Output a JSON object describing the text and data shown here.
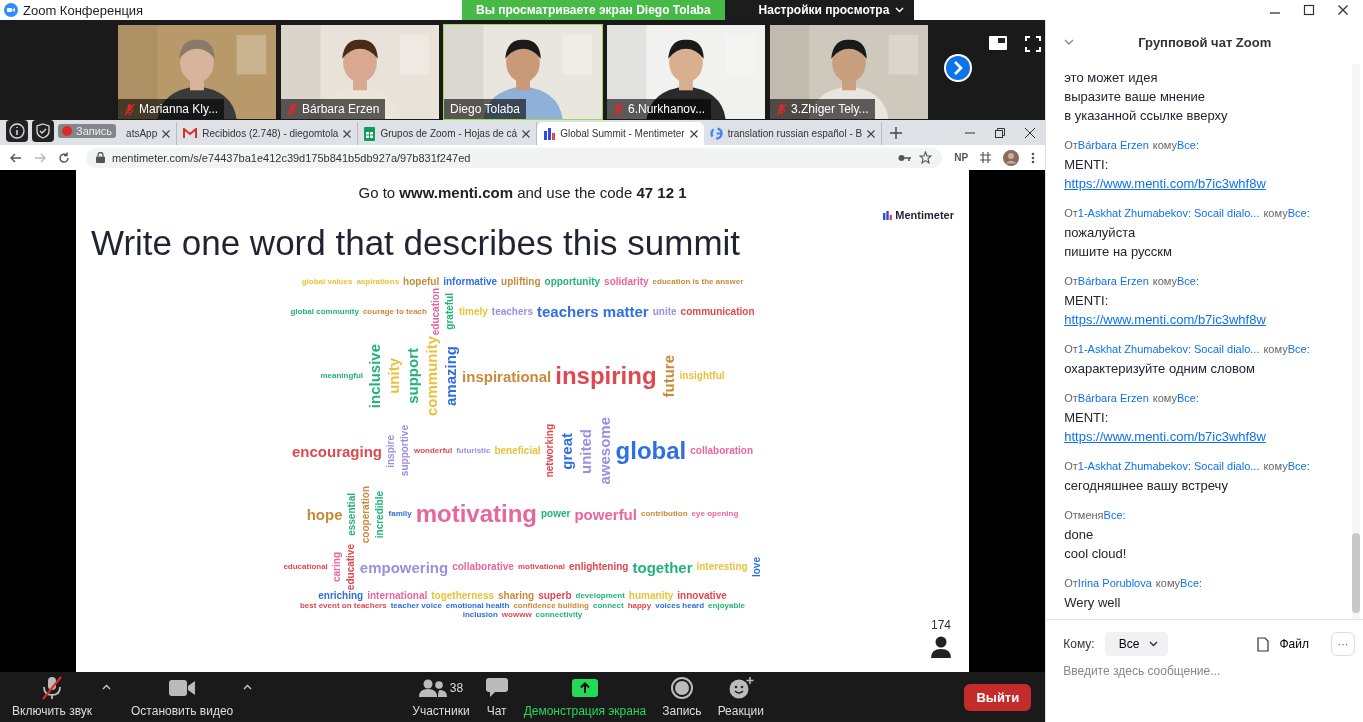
{
  "window": {
    "title": "Zoom Конференция"
  },
  "share_banner": {
    "text": "Вы просматриваете экран Diego Tolaba",
    "view_options": "Настройки просмотра"
  },
  "participants": [
    {
      "name": "Marianna Kly...",
      "muted": true,
      "speaking": false
    },
    {
      "name": "Bárbara Erzen",
      "muted": true,
      "speaking": false
    },
    {
      "name": "Diego Tolaba",
      "muted": false,
      "speaking": true
    },
    {
      "name": "6.Nurkhanov...",
      "muted": true,
      "speaking": false
    },
    {
      "name": "3.Zhiger Tely...",
      "muted": true,
      "speaking": false
    }
  ],
  "recording": {
    "label": "Запись"
  },
  "browser": {
    "tabs": [
      {
        "label": "atsApp",
        "selected": false
      },
      {
        "label": "Recibidos (2.748) - diegomtola",
        "selected": false
      },
      {
        "label": "Grupos de Zoom - Hojas de cá",
        "selected": false
      },
      {
        "label": "Global Summit - Mentimeter",
        "selected": true
      },
      {
        "label": "translation russian español - B",
        "selected": false
      }
    ],
    "url": "mentimeter.com/s/e74437ba1e412c39d175b841b5db927a/97b831f247ed",
    "extension": "NP"
  },
  "slide": {
    "instructions": "Go to **www.menti.com** and use the code **47 12 1**",
    "title": "Write one word that describes this summit",
    "logo": "Mentimeter",
    "responses": "174",
    "words": [
      {
        "text": "global values",
        "color": "#e8c23a",
        "kind": "s",
        "vertical": false
      },
      {
        "text": "aspirations",
        "color": "#e8c23a",
        "kind": "s",
        "vertical": false
      },
      {
        "text": "hopeful",
        "color": "#c98a3a",
        "kind": "m",
        "vertical": false
      },
      {
        "text": "informative",
        "color": "#2f6fe0",
        "kind": "m",
        "vertical": false
      },
      {
        "text": "uplifting",
        "color": "#c98a3a",
        "kind": "m",
        "vertical": false
      },
      {
        "text": "opportunity",
        "color": "#22b37a",
        "kind": "m",
        "vertical": false
      },
      {
        "text": "solidarity",
        "color": "#e8669b",
        "kind": "m",
        "vertical": false
      },
      {
        "text": "education is the answer",
        "color": "#c98a3a",
        "kind": "s",
        "vertical": false
      },
      {
        "text": "global community",
        "color": "#22b37a",
        "kind": "s",
        "vertical": false
      },
      {
        "text": "courage to teach",
        "color": "#c98a3a",
        "kind": "s",
        "vertical": false
      },
      {
        "text": "education",
        "color": "#e8669b",
        "kind": "m",
        "vertical": true
      },
      {
        "text": "grateful",
        "color": "#22b37a",
        "kind": "m",
        "vertical": true
      },
      {
        "text": "timely",
        "color": "#e8c23a",
        "kind": "m",
        "vertical": false
      },
      {
        "text": "teachers",
        "color": "#9a8fe0",
        "kind": "m",
        "vertical": false
      },
      {
        "text": "teachers matter",
        "color": "#2f6fe0",
        "kind": "l",
        "vertical": false
      },
      {
        "text": "unite",
        "color": "#9a8fe0",
        "kind": "m",
        "vertical": false
      },
      {
        "text": "communication",
        "color": "#e0484f",
        "kind": "m",
        "vertical": false
      },
      {
        "text": "meaningful",
        "color": "#22b37a",
        "kind": "s",
        "vertical": false
      },
      {
        "text": "inclusive",
        "color": "#22b37a",
        "kind": "l",
        "vertical": true
      },
      {
        "text": "unity",
        "color": "#e8c23a",
        "kind": "l",
        "vertical": true
      },
      {
        "text": "support",
        "color": "#22b37a",
        "kind": "l",
        "vertical": true
      },
      {
        "text": "community",
        "color": "#e8c23a",
        "kind": "l",
        "vertical": true
      },
      {
        "text": "amazing",
        "color": "#2f6fe0",
        "kind": "l",
        "vertical": true
      },
      {
        "text": "inspirational",
        "color": "#c98a3a",
        "kind": "l",
        "vertical": false
      },
      {
        "text": "inspiring",
        "color": "#e0484f",
        "kind": "xl",
        "vertical": false
      },
      {
        "text": "future",
        "color": "#c98a3a",
        "kind": "l",
        "vertical": true
      },
      {
        "text": "insightful",
        "color": "#e8c23a",
        "kind": "m",
        "vertical": false
      },
      {
        "text": "encouraging",
        "color": "#e0484f",
        "kind": "l",
        "vertical": false
      },
      {
        "text": "inspire",
        "color": "#9a8fe0",
        "kind": "m",
        "vertical": true
      },
      {
        "text": "supportive",
        "color": "#9a8fe0",
        "kind": "m",
        "vertical": true
      },
      {
        "text": "wonderful",
        "color": "#e0484f",
        "kind": "s",
        "vertical": false
      },
      {
        "text": "futuristic",
        "color": "#9a8fe0",
        "kind": "s",
        "vertical": false
      },
      {
        "text": "beneficial",
        "color": "#e8c23a",
        "kind": "m",
        "vertical": false
      },
      {
        "text": "networking",
        "color": "#e0484f",
        "kind": "m",
        "vertical": true
      },
      {
        "text": "great",
        "color": "#2f6fe0",
        "kind": "l",
        "vertical": true
      },
      {
        "text": "united",
        "color": "#9a8fe0",
        "kind": "l",
        "vertical": true
      },
      {
        "text": "awesome",
        "color": "#9a8fe0",
        "kind": "l",
        "vertical": true
      },
      {
        "text": "global",
        "color": "#2f6fe0",
        "kind": "xl",
        "vertical": false
      },
      {
        "text": "collaboration",
        "color": "#e8669b",
        "kind": "m",
        "vertical": false
      },
      {
        "text": "hope",
        "color": "#c98a3a",
        "kind": "l",
        "vertical": false
      },
      {
        "text": "essential",
        "color": "#22b37a",
        "kind": "m",
        "vertical": true
      },
      {
        "text": "cooperation",
        "color": "#c98a3a",
        "kind": "m",
        "vertical": true
      },
      {
        "text": "incredible",
        "color": "#22b37a",
        "kind": "m",
        "vertical": true
      },
      {
        "text": "family",
        "color": "#2f6fe0",
        "kind": "s",
        "vertical": false
      },
      {
        "text": "motivating",
        "color": "#e8669b",
        "kind": "xl",
        "vertical": false
      },
      {
        "text": "power",
        "color": "#22b37a",
        "kind": "m",
        "vertical": false
      },
      {
        "text": "powerful",
        "color": "#e8669b",
        "kind": "l",
        "vertical": false
      },
      {
        "text": "contribution",
        "color": "#c98a3a",
        "kind": "s",
        "vertical": false
      },
      {
        "text": "eye opening",
        "color": "#e8669b",
        "kind": "s",
        "vertical": false
      },
      {
        "text": "educational",
        "color": "#e0484f",
        "kind": "s",
        "vertical": false
      },
      {
        "text": "caring",
        "color": "#e8669b",
        "kind": "m",
        "vertical": true
      },
      {
        "text": "educative",
        "color": "#e0484f",
        "kind": "m",
        "vertical": true
      },
      {
        "text": "empowering",
        "color": "#9a8fe0",
        "kind": "l",
        "vertical": false
      },
      {
        "text": "collaborative",
        "color": "#e8669b",
        "kind": "m",
        "vertical": false
      },
      {
        "text": "motivational",
        "color": "#e0484f",
        "kind": "s",
        "vertical": false
      },
      {
        "text": "enlightening",
        "color": "#e0484f",
        "kind": "m",
        "vertical": false
      },
      {
        "text": "together",
        "color": "#22b37a",
        "kind": "l",
        "vertical": false
      },
      {
        "text": "interesting",
        "color": "#e8c23a",
        "kind": "m",
        "vertical": false
      },
      {
        "text": "love",
        "color": "#2f6fe0",
        "kind": "m",
        "vertical": true
      },
      {
        "text": "enriching",
        "color": "#2f6fe0",
        "kind": "m",
        "vertical": false
      },
      {
        "text": "international",
        "color": "#e8669b",
        "kind": "m",
        "vertical": false
      },
      {
        "text": "togetherness",
        "color": "#e8c23a",
        "kind": "m",
        "vertical": false
      },
      {
        "text": "sharing",
        "color": "#c98a3a",
        "kind": "m",
        "vertical": false
      },
      {
        "text": "superb",
        "color": "#e0484f",
        "kind": "m",
        "vertical": false
      },
      {
        "text": "development",
        "color": "#22b37a",
        "kind": "s",
        "vertical": false
      },
      {
        "text": "humanity",
        "color": "#e8c23a",
        "kind": "m",
        "vertical": false
      },
      {
        "text": "innovative",
        "color": "#e0484f",
        "kind": "m",
        "vertical": false
      },
      {
        "text": "best event on teachers",
        "color": "#e0484f",
        "kind": "s",
        "vertical": false
      },
      {
        "text": "teacher voice",
        "color": "#2f6fe0",
        "kind": "s",
        "vertical": false
      },
      {
        "text": "emotional health",
        "color": "#2f6fe0",
        "kind": "s",
        "vertical": false
      },
      {
        "text": "confidence building",
        "color": "#c98a3a",
        "kind": "s",
        "vertical": false
      },
      {
        "text": "connect",
        "color": "#22b37a",
        "kind": "s",
        "vertical": false
      },
      {
        "text": "happy",
        "color": "#e0484f",
        "kind": "s",
        "vertical": false
      },
      {
        "text": "voices heard",
        "color": "#2f6fe0",
        "kind": "s",
        "vertical": false
      },
      {
        "text": "enjoyable",
        "color": "#22b37a",
        "kind": "s",
        "vertical": false
      },
      {
        "text": "inclusion",
        "color": "#2f6fe0",
        "kind": "s",
        "vertical": false
      },
      {
        "text": "wowww",
        "color": "#e0484f",
        "kind": "s",
        "vertical": false
      },
      {
        "text": "connectivity",
        "color": "#22b37a",
        "kind": "s",
        "vertical": false
      }
    ]
  },
  "toolbar": [
    {
      "label": "Включить звук",
      "kind": "mic-muted",
      "caret": true
    },
    {
      "label": "Остановить видео",
      "kind": "video",
      "caret": true
    },
    {
      "label": "Участники",
      "kind": "participants",
      "caret": false,
      "count": "38"
    },
    {
      "label": "Чат",
      "kind": "chat",
      "caret": false
    },
    {
      "label": "Демонстрация экрана",
      "kind": "share",
      "caret": false
    },
    {
      "label": "Запись",
      "kind": "record",
      "caret": false
    },
    {
      "label": "Реакции",
      "kind": "reactions",
      "caret": false
    }
  ],
  "leave_button": "Выйти",
  "chat": {
    "title": "Групповой чат Zoom",
    "messages": [
      {
        "lines": [
          {
            "text": "это может идея",
            "link": false
          },
          {
            "text": "выразите ваше мнение",
            "link": false
          },
          {
            "text": "в указанной ссылке вверху",
            "link": false
          }
        ]
      },
      {
        "header": {
          "from": "От",
          "sender": "Bárbara Erzen",
          "self": false,
          "to": "кому",
          "recipient": "Все:"
        },
        "lines": [
          {
            "text": "MENTI:",
            "link": false
          },
          {
            "text": "https://www.menti.com/b7ic3whf8w",
            "link": true
          }
        ]
      },
      {
        "header": {
          "from": "От",
          "sender": "1-Askhat Zhumabekov: Socail dialo...",
          "self": false,
          "to": "кому",
          "recipient": "Все:"
        },
        "lines": [
          {
            "text": "пожалуйста",
            "link": false
          },
          {
            "text": "пишите на русскм",
            "link": false
          }
        ]
      },
      {
        "header": {
          "from": "От",
          "sender": "Bárbara Erzen",
          "self": false,
          "to": "кому",
          "recipient": "Все:"
        },
        "lines": [
          {
            "text": "MENTI:",
            "link": false
          },
          {
            "text": "https://www.menti.com/b7ic3whf8w",
            "link": true
          }
        ]
      },
      {
        "header": {
          "from": "От",
          "sender": "1-Askhat Zhumabekov: Socail dialo...",
          "self": false,
          "to": "кому",
          "recipient": "Все:"
        },
        "lines": [
          {
            "text": "охарактеризуйте одним словом",
            "link": false
          }
        ]
      },
      {
        "header": {
          "from": "От",
          "sender": "Bárbara Erzen",
          "self": false,
          "to": "кому",
          "recipient": "Все:"
        },
        "lines": [
          {
            "text": "MENTI:",
            "link": false
          },
          {
            "text": "https://www.menti.com/b7ic3whf8w",
            "link": true
          }
        ]
      },
      {
        "header": {
          "from": "От",
          "sender": "1-Askhat Zhumabekov: Socail dialo...",
          "self": false,
          "to": "кому",
          "recipient": "Все:"
        },
        "lines": [
          {
            "text": "сегодняшнее вашу встречу",
            "link": false
          }
        ]
      },
      {
        "header": {
          "from": "От",
          "sender": "меня",
          "self": true,
          "recipient": "Все:"
        },
        "lines": [
          {
            "text": "done",
            "link": false
          },
          {
            "text": "cool cloud!",
            "link": false
          }
        ]
      },
      {
        "header": {
          "from": "От",
          "sender": "Irina Porublova",
          "self": false,
          "to": "кому",
          "recipient": "Все:"
        },
        "lines": [
          {
            "text": "Wery well",
            "link": false
          }
        ]
      }
    ],
    "to_label": "Кому:",
    "recipient": "Все",
    "file_button": "Файл",
    "more_button": "···",
    "input": {
      "placeholder": "Введите здесь сообщение..."
    }
  }
}
